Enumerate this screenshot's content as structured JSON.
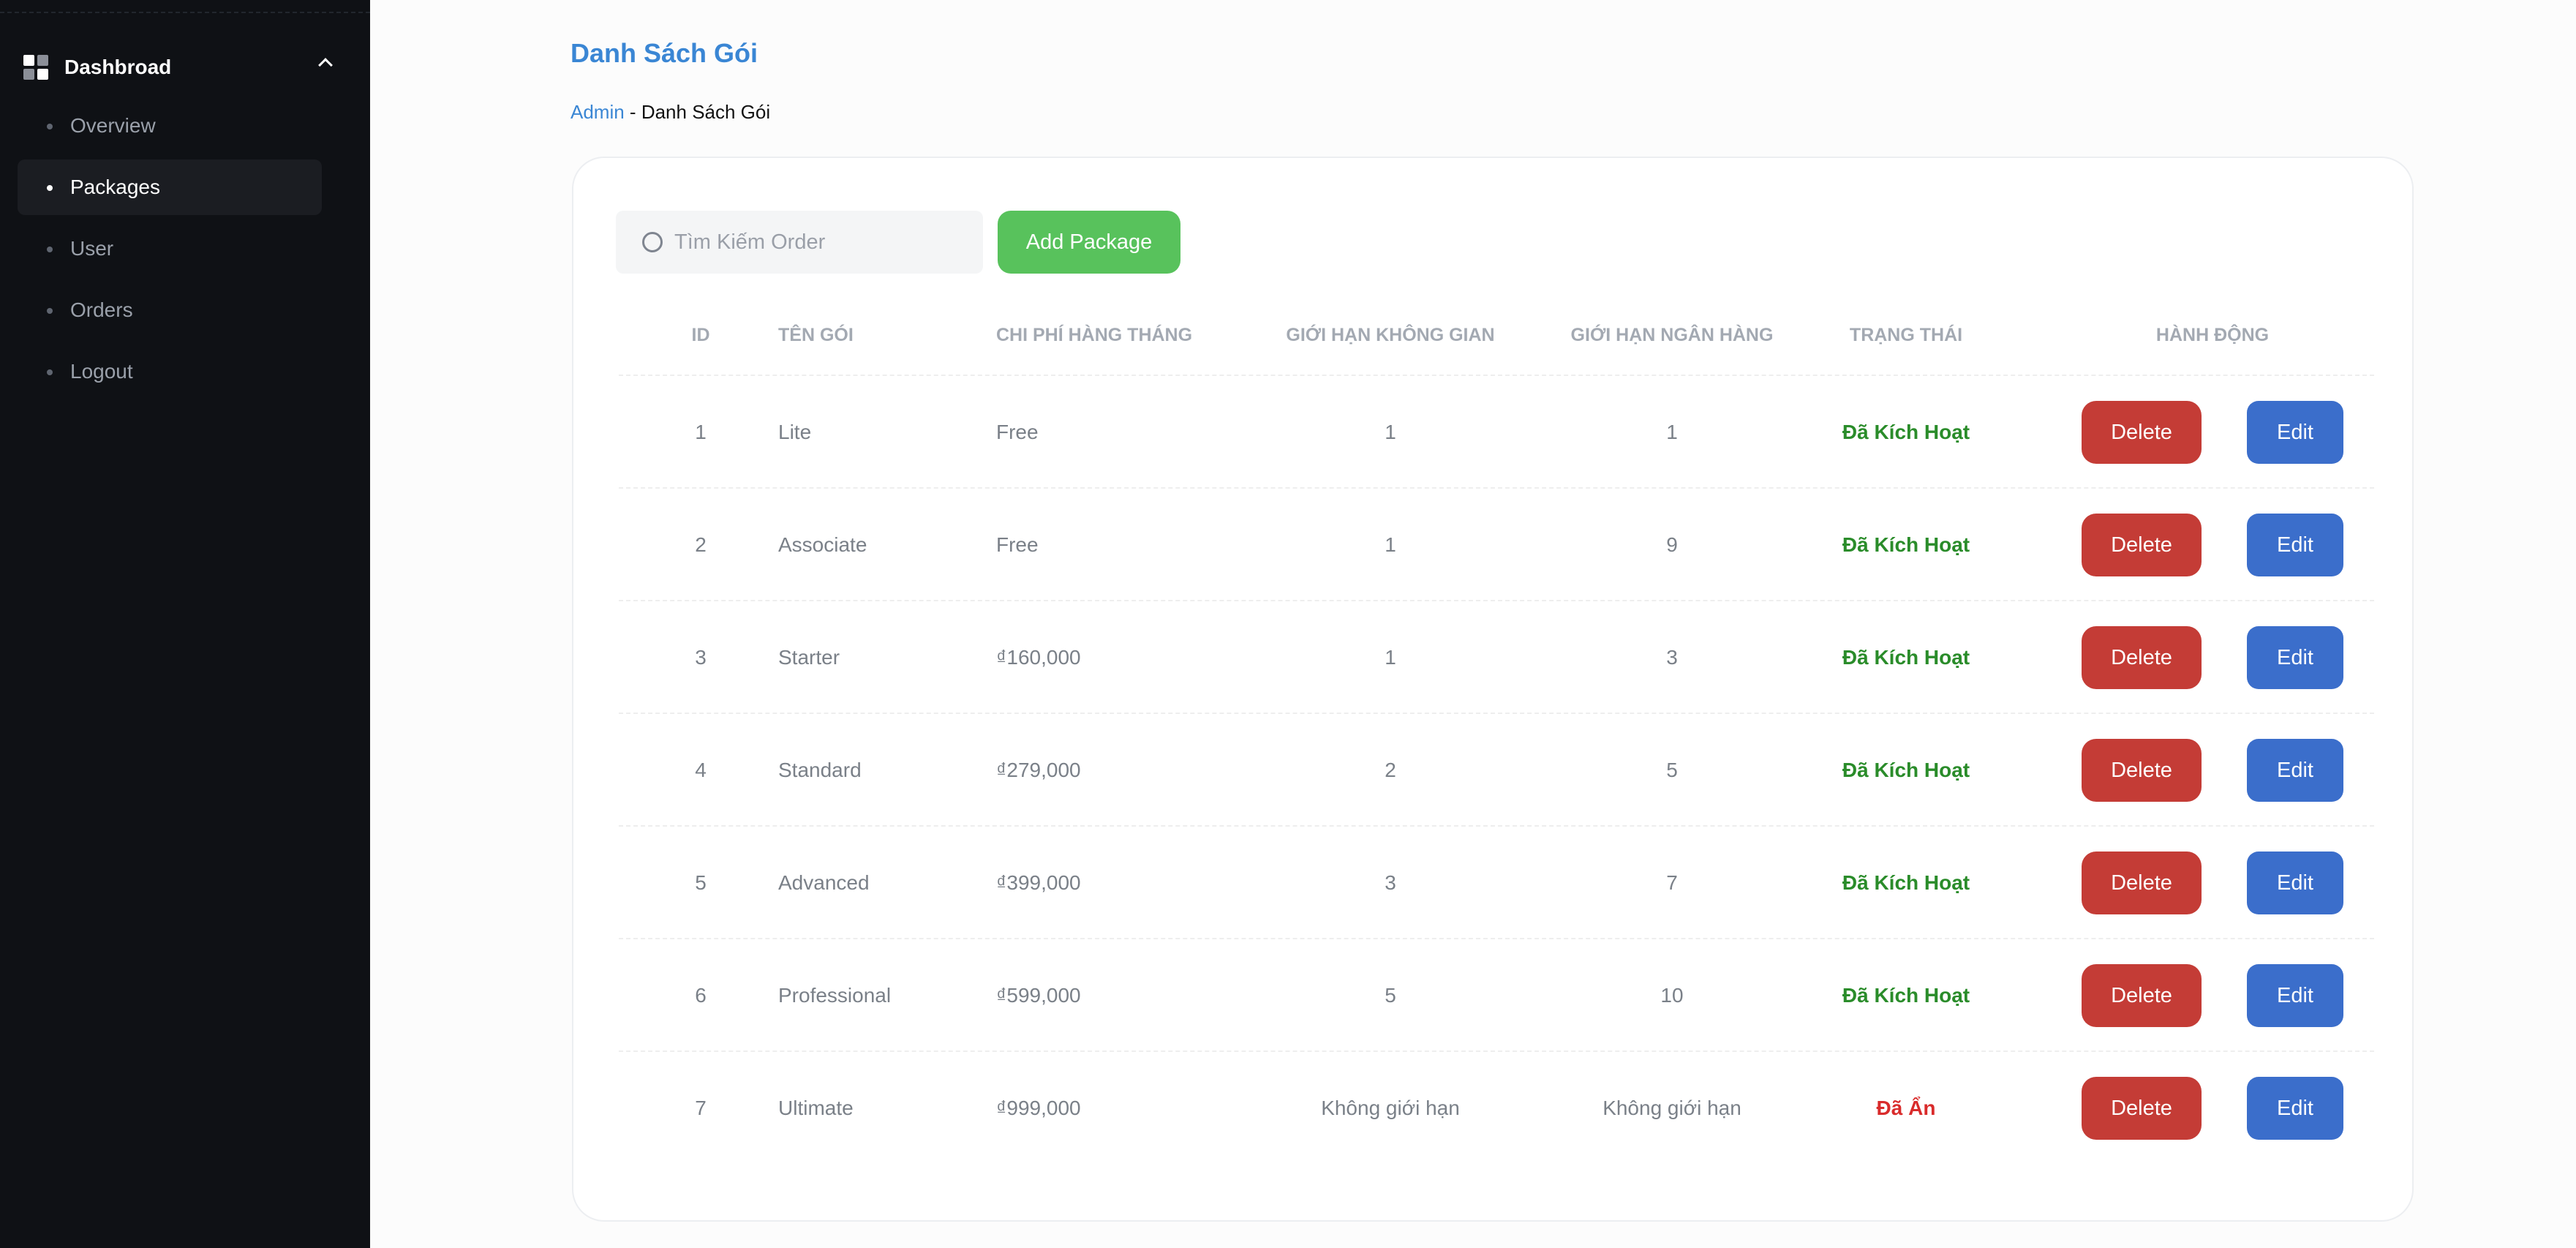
{
  "sidebar": {
    "section": "Dashbroad",
    "items": [
      {
        "label": "Overview",
        "active": false
      },
      {
        "label": "Packages",
        "active": true
      },
      {
        "label": "User",
        "active": false
      },
      {
        "label": "Orders",
        "active": false
      },
      {
        "label": "Logout",
        "active": false
      }
    ]
  },
  "header": {
    "title": "Danh Sách Gói",
    "breadcrumb_link": "Admin",
    "breadcrumb_separator": " - ",
    "breadcrumb_current": "Danh Sách Gói"
  },
  "toolbar": {
    "search_placeholder": "Tìm Kiếm Order",
    "search_value": "",
    "add_label": "Add Package"
  },
  "table": {
    "columns": [
      "ID",
      "TÊN GÓI",
      "CHI PHÍ HÀNG THÁNG",
      "GIỚI HẠN KHÔNG GIAN",
      "GIỚI HẠN NGÂN HÀNG",
      "TRẠNG THÁI",
      "HÀNH ĐỘNG"
    ],
    "rows": [
      {
        "id": "1",
        "name": "Lite",
        "cost": "Free",
        "space": "1",
        "bank": "1",
        "status": "Đã Kích Hoạt",
        "active": true
      },
      {
        "id": "2",
        "name": "Associate",
        "cost": "Free",
        "space": "1",
        "bank": "9",
        "status": "Đã Kích Hoạt",
        "active": true
      },
      {
        "id": "3",
        "name": "Starter",
        "cost": "₫160,000",
        "space": "1",
        "bank": "3",
        "status": "Đã Kích Hoạt",
        "active": true
      },
      {
        "id": "4",
        "name": "Standard",
        "cost": "₫279,000",
        "space": "2",
        "bank": "5",
        "status": "Đã Kích Hoạt",
        "active": true
      },
      {
        "id": "5",
        "name": "Advanced",
        "cost": "₫399,000",
        "space": "3",
        "bank": "7",
        "status": "Đã Kích Hoạt",
        "active": true
      },
      {
        "id": "6",
        "name": "Professional",
        "cost": "₫599,000",
        "space": "5",
        "bank": "10",
        "status": "Đã Kích Hoạt",
        "active": true
      },
      {
        "id": "7",
        "name": "Ultimate",
        "cost": "₫999,000",
        "space": "Không giới hạn",
        "bank": "Không giới hạn",
        "status": "Đã Ẩn",
        "active": false
      }
    ],
    "delete_label": "Delete",
    "edit_label": "Edit"
  },
  "colors": {
    "accent": "#3a86d4",
    "add": "#58c25c",
    "delete": "#c43c36",
    "edit": "#3b6ecb",
    "status_active": "#2a8c2a",
    "status_hidden": "#d92b2b",
    "sidebar_bg": "#0f1115"
  },
  "icons": [
    "dashboard-icon",
    "chevron-up-icon",
    "search-icon"
  ]
}
